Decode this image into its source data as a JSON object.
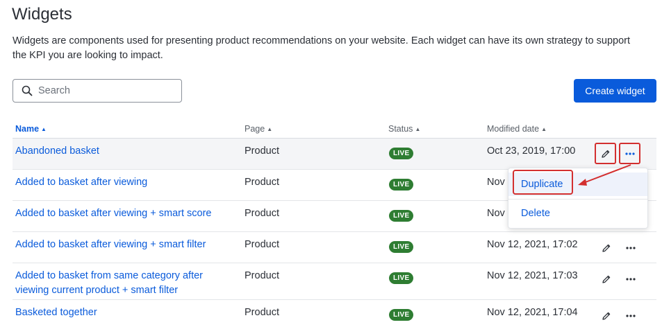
{
  "page": {
    "title": "Widgets",
    "description": "Widgets are components used for presenting product recommendations on your website. Each widget can have its own strategy to support the KPI you are looking to impact."
  },
  "search": {
    "placeholder": "Search",
    "value": ""
  },
  "toolbar": {
    "create_label": "Create widget"
  },
  "table": {
    "columns": [
      {
        "label": "Name",
        "sort": "▲"
      },
      {
        "label": "Page",
        "sort": "▲"
      },
      {
        "label": "Status",
        "sort": "▲"
      },
      {
        "label": "Modified date",
        "sort": "▲"
      }
    ],
    "rows": [
      {
        "name": "Abandoned basket",
        "page": "Product",
        "status": "LIVE",
        "modified": "Oct 23, 2019, 17:00"
      },
      {
        "name": "Added to basket after viewing",
        "page": "Product",
        "status": "LIVE",
        "modified": "Nov"
      },
      {
        "name": "Added to basket after viewing + smart score",
        "page": "Product",
        "status": "LIVE",
        "modified": "Nov"
      },
      {
        "name": "Added to basket after viewing + smart filter",
        "page": "Product",
        "status": "LIVE",
        "modified": "Nov 12, 2021, 17:02"
      },
      {
        "name": "Added to basket from same category after viewing current product + smart filter",
        "page": "Product",
        "status": "LIVE",
        "modified": "Nov 12, 2021, 17:03"
      },
      {
        "name": "Basketed together",
        "page": "Product",
        "status": "LIVE",
        "modified": "Nov 12, 2021, 17:04"
      }
    ]
  },
  "menu": {
    "duplicate_label": "Duplicate",
    "delete_label": "Delete"
  },
  "icons": {
    "search": "search-icon",
    "edit": "pencil-icon",
    "more": "more-horizontal-icon"
  },
  "colors": {
    "accent": "#0a5bdb",
    "live": "#2e7d32",
    "highlight": "#d32f2f"
  }
}
